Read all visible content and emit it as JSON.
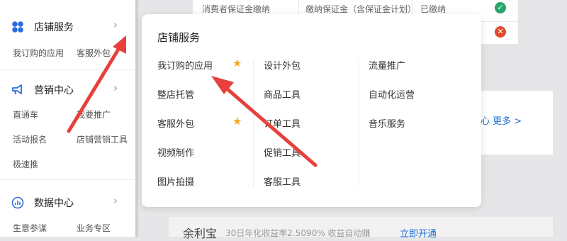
{
  "sidebar": {
    "shop_services": {
      "title": "店铺服务",
      "links": [
        "我订购的应用",
        "客服外包"
      ]
    },
    "marketing": {
      "title": "营销中心",
      "links": [
        "直通车",
        "我要推广",
        "活动报名",
        "店铺营销工具",
        "极速推"
      ]
    },
    "data_center": {
      "title": "数据中心",
      "links": [
        "生意参谋",
        "业务专区"
      ]
    }
  },
  "background": {
    "row1_col1": "消费者保证金缴纳",
    "row1_col2": "缴纳保证金（含保证金计划）",
    "row1_status": "已缴纳",
    "card_links": "心 更多 >",
    "bottom_title": "余利宝",
    "bottom_text": "30日年化收益率2.5090% 收益自动赚",
    "bottom_link": "立即开通"
  },
  "popup": {
    "title": "店铺服务",
    "columns": [
      [
        {
          "label": "我订购的应用",
          "starred": true
        },
        {
          "label": "整店托管",
          "starred": false
        },
        {
          "label": "客服外包",
          "starred": true
        },
        {
          "label": "视频制作",
          "starred": false
        },
        {
          "label": "图片拍摄",
          "starred": false
        }
      ],
      [
        {
          "label": "设计外包"
        },
        {
          "label": "商品工具"
        },
        {
          "label": "订单工具"
        },
        {
          "label": "促销工具"
        },
        {
          "label": "客服工具"
        }
      ],
      [
        {
          "label": "流量推广"
        },
        {
          "label": "自动化运营"
        },
        {
          "label": "音乐服务"
        }
      ]
    ]
  },
  "colors": {
    "accent_blue": "#1f6fd6",
    "annotation_red": "#e8403a",
    "star": "#f5a623",
    "ok_green": "#28a56a",
    "error_red": "#e04a2b"
  }
}
